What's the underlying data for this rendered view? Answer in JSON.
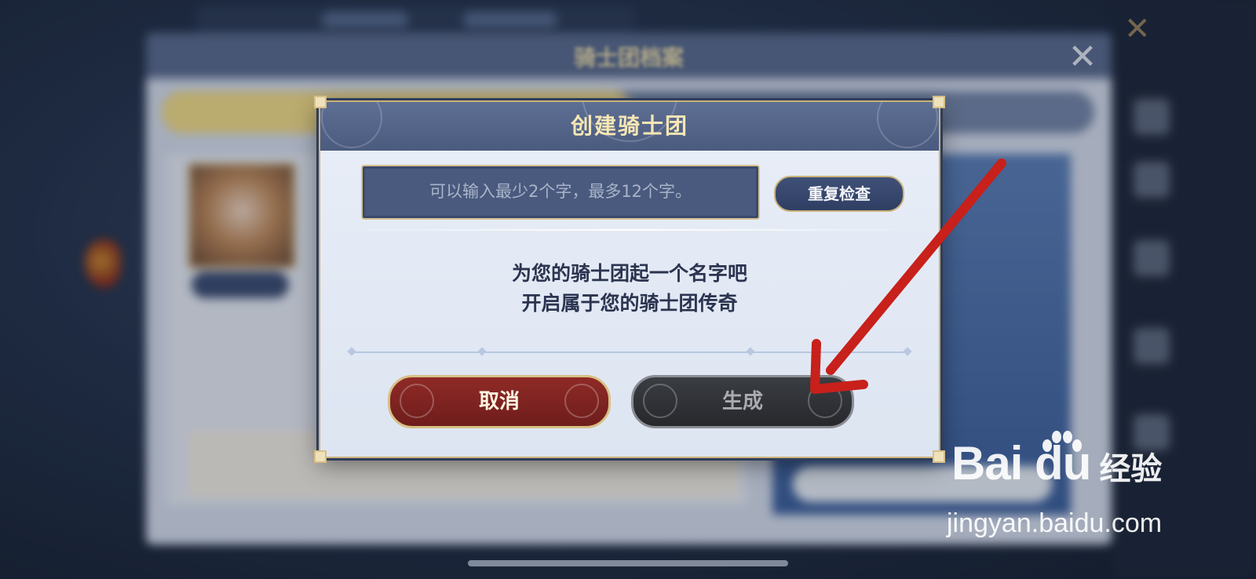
{
  "background": {
    "panel_title": "骑士团档案"
  },
  "dialog": {
    "title": "创建骑士团",
    "name_input": {
      "placeholder": "可以输入最少2个字，最多12个字。",
      "value": ""
    },
    "recheck_button": "重复检查",
    "message_line1": "为您的骑士团起一个名字吧",
    "message_line2": "开启属于您的骑士团传奇",
    "cancel_button": "取消",
    "generate_button": "生成"
  },
  "annotation": {
    "arrow_color": "#c8201a"
  },
  "watermark": {
    "brand": "Bai du",
    "brand_suffix": "经验",
    "url": "jingyan.baidu.com"
  },
  "colors": {
    "gold_border": "#c9b27a",
    "cancel_red": "#8f2a26",
    "generate_dark": "#2f3236"
  }
}
